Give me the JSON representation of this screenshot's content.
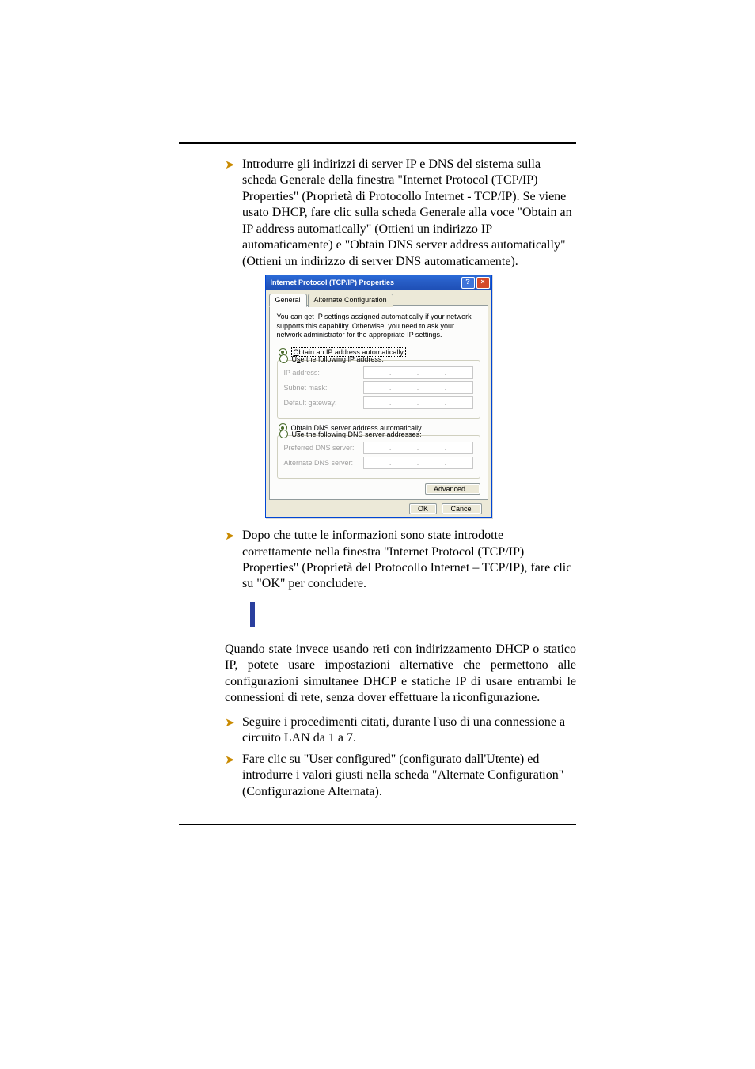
{
  "bullets": {
    "b1": "Introdurre gli indirizzi di server IP e DNS del sistema sulla scheda Generale della finestra \"Internet Protocol (TCP/IP) Properties\" (Proprietà di Protocollo Internet - TCP/IP).  Se viene usato DHCP, fare clic sulla scheda Generale alla voce \"Obtain an IP address automatically\" (Ottieni un indirizzo IP automaticamente) e \"Obtain DNS server address automatically\" (Ottieni un indirizzo di server DNS automaticamente).",
    "b2": "Dopo che tutte le informazioni sono state introdotte correttamente nella finestra \"Internet Protocol (TCP/IP) Properties\" (Proprietà del Protocollo Internet – TCP/IP), fare clic su \"OK\" per concludere.",
    "b3": "Seguire i procedimenti citati, durante l'uso di una connessione a circuito LAN da 1 a 7.",
    "b4": "Fare clic su \"User configured\" (configurato dall'Utente) ed introdurre i valori giusti nella scheda \"Alternate Configuration\" (Configurazione Alternata)."
  },
  "body": {
    "para1": "Quando state invece usando reti con indirizzamento DHCP o statico IP, potete usare impostazioni alternative che permettono alle configurazioni simultanee DHCP e statiche IP di usare entrambi le connessioni di rete, senza dover effettuare la riconfigurazione."
  },
  "dialog": {
    "title": "Internet Protocol (TCP/IP) Properties",
    "tabs": {
      "general": "General",
      "alt": "Alternate Configuration"
    },
    "intro": "You can get IP settings assigned automatically if your network supports this capability. Otherwise, you need to ask your network administrator for the appropriate IP settings.",
    "radios": {
      "obtain_ip": "Obtain an IP address automatically",
      "use_ip": "Use the following IP address:",
      "obtain_dns": "Obtain DNS server address automatically",
      "use_dns": "Use the following DNS server addresses:"
    },
    "fields": {
      "ip": "IP address:",
      "subnet": "Subnet mask:",
      "gateway": "Default gateway:",
      "pref_dns": "Preferred DNS server:",
      "alt_dns": "Alternate DNS server:"
    },
    "buttons": {
      "advanced": "Advanced...",
      "ok": "OK",
      "cancel": "Cancel"
    }
  }
}
